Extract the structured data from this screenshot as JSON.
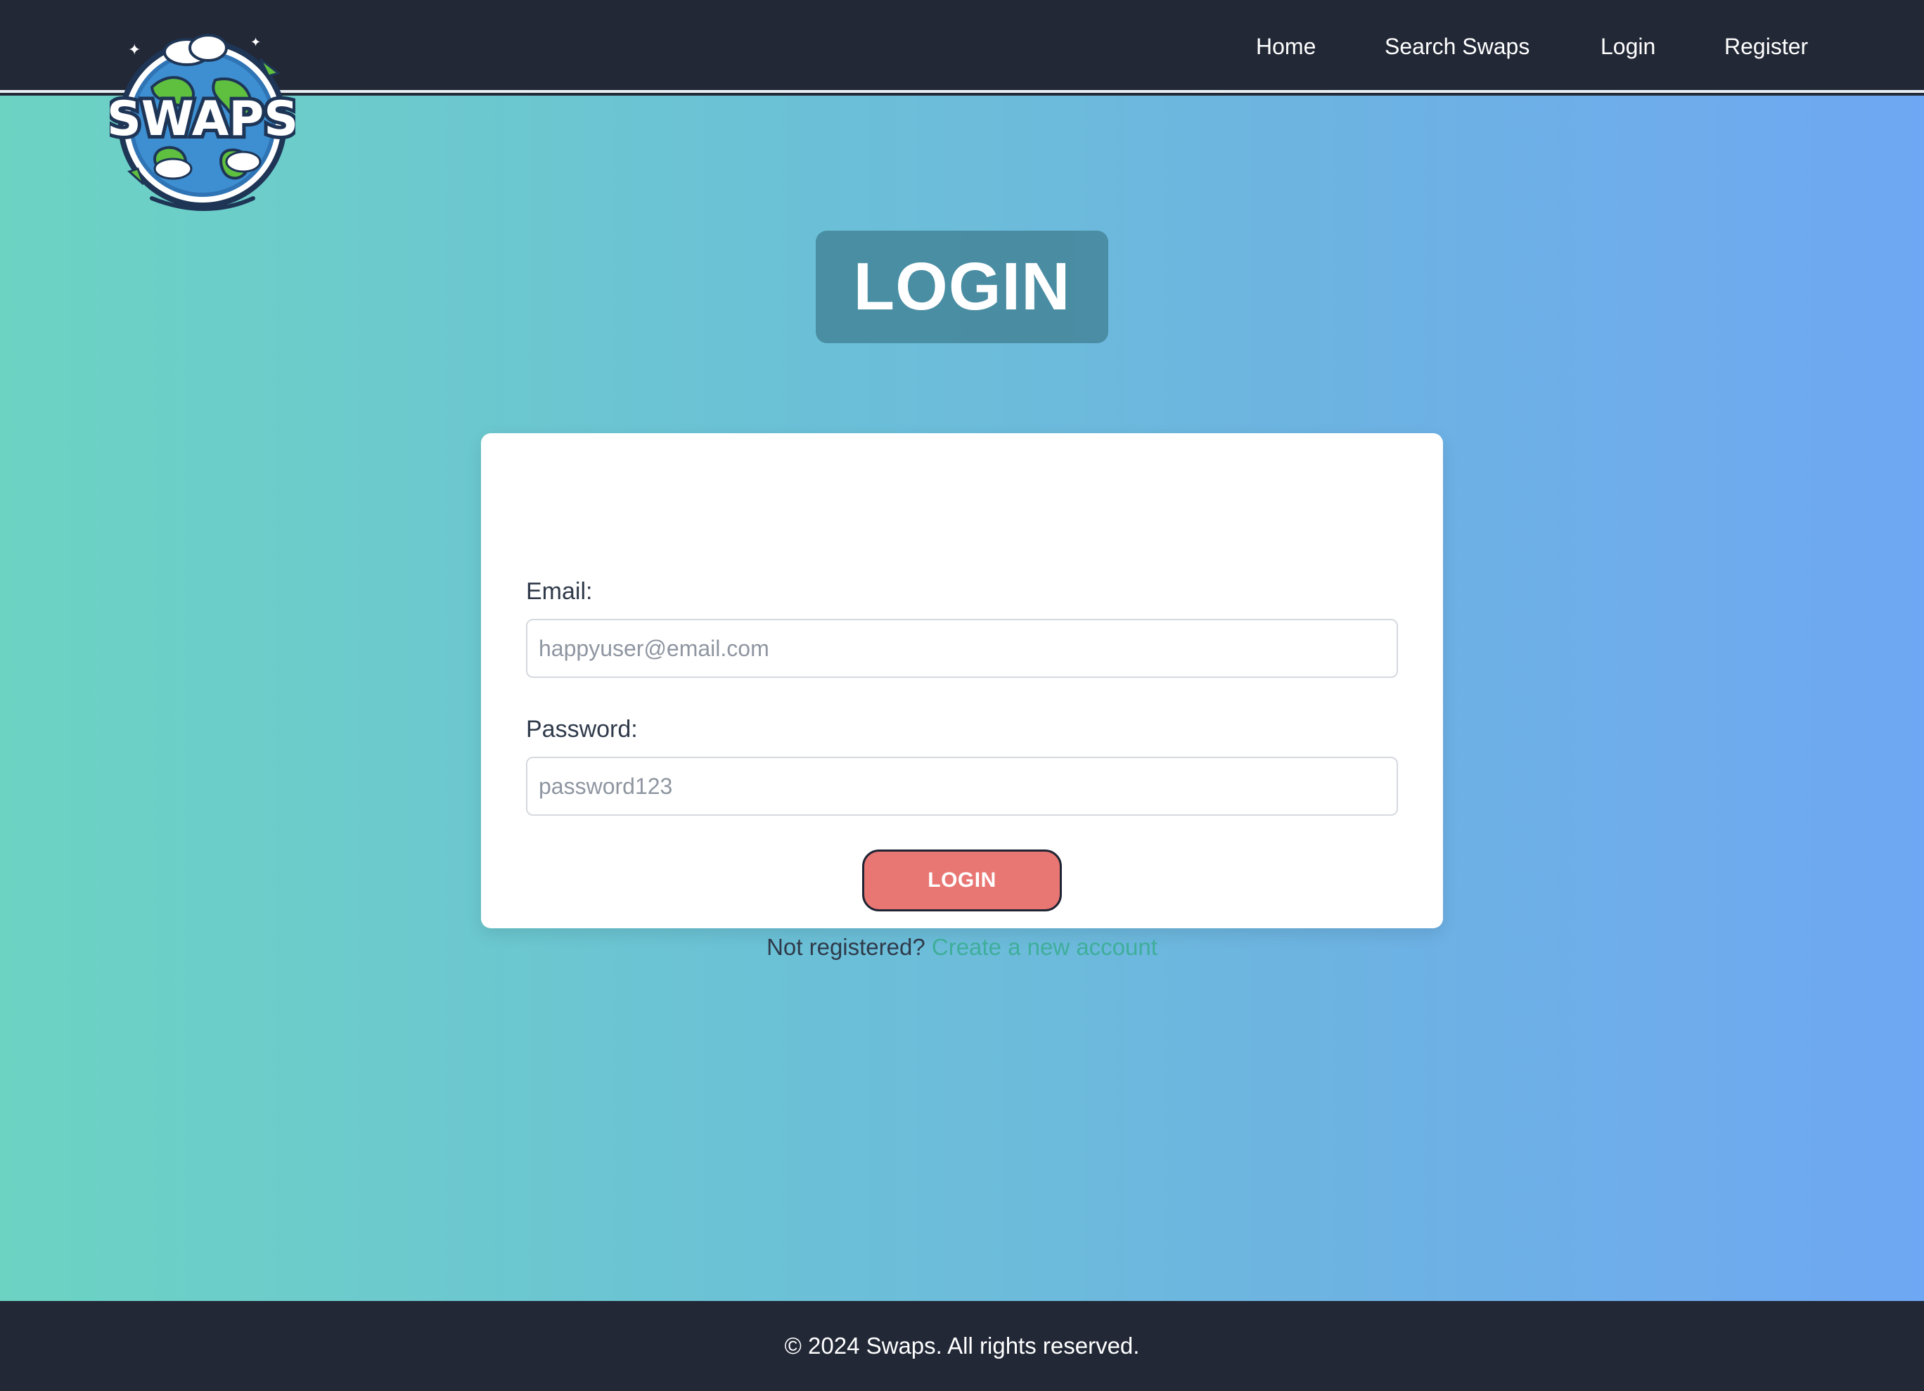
{
  "nav": {
    "home": "Home",
    "search_swaps": "Search Swaps",
    "login": "Login",
    "register": "Register"
  },
  "logo": {
    "text": "SWAPS",
    "icon": "globe-swap-logo"
  },
  "page": {
    "title": "LOGIN"
  },
  "form": {
    "email_label": "Email:",
    "email_placeholder": "happyuser@email.com",
    "email_value": "",
    "password_label": "Password:",
    "password_placeholder": "password123",
    "password_value": "",
    "submit_label": "LOGIN",
    "register_prompt": "Not registered?",
    "register_link": "Create a new account"
  },
  "footer": {
    "text": "© 2024 Swaps. All rights reserved."
  },
  "colors": {
    "navbar": "#222836",
    "gradient_start": "#6cd3c3",
    "gradient_end": "#6ea7f3",
    "title_box": "#408093",
    "button": "#e87774",
    "link": "#3fae9a"
  }
}
